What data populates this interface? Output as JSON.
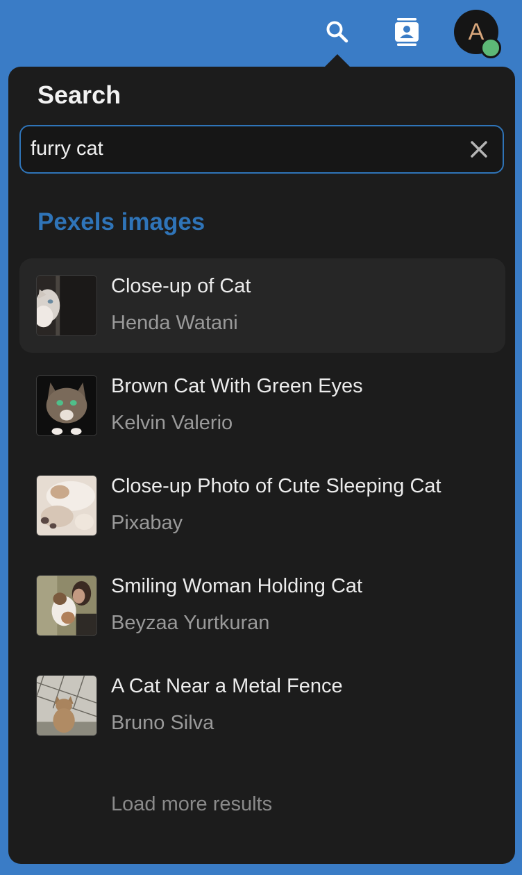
{
  "topbar": {
    "icons": [
      "search-icon",
      "contacts-icon"
    ],
    "avatar_initial": "A",
    "presence_color": "#5db877"
  },
  "panel": {
    "title": "Search",
    "search": {
      "value": "furry cat",
      "placeholder": "",
      "clear_icon": "close-icon"
    },
    "section_heading": "Pexels images",
    "results": [
      {
        "title": "Close-up of Cat",
        "author": "Henda Watani",
        "active": true
      },
      {
        "title": "Brown Cat With Green Eyes",
        "author": "Kelvin Valerio",
        "active": false
      },
      {
        "title": "Close-up Photo of Cute Sleeping Cat",
        "author": "Pixabay",
        "active": false
      },
      {
        "title": "Smiling Woman Holding Cat",
        "author": "Beyzaa Yurtkuran",
        "active": false
      },
      {
        "title": "A Cat Near a Metal Fence",
        "author": "Bruno Silva",
        "active": false
      }
    ],
    "load_more_label": "Load more results"
  },
  "colors": {
    "background": "#3a7cc6",
    "panel": "#1c1c1c",
    "accent": "#2f74b8",
    "active_row": "#262626"
  }
}
